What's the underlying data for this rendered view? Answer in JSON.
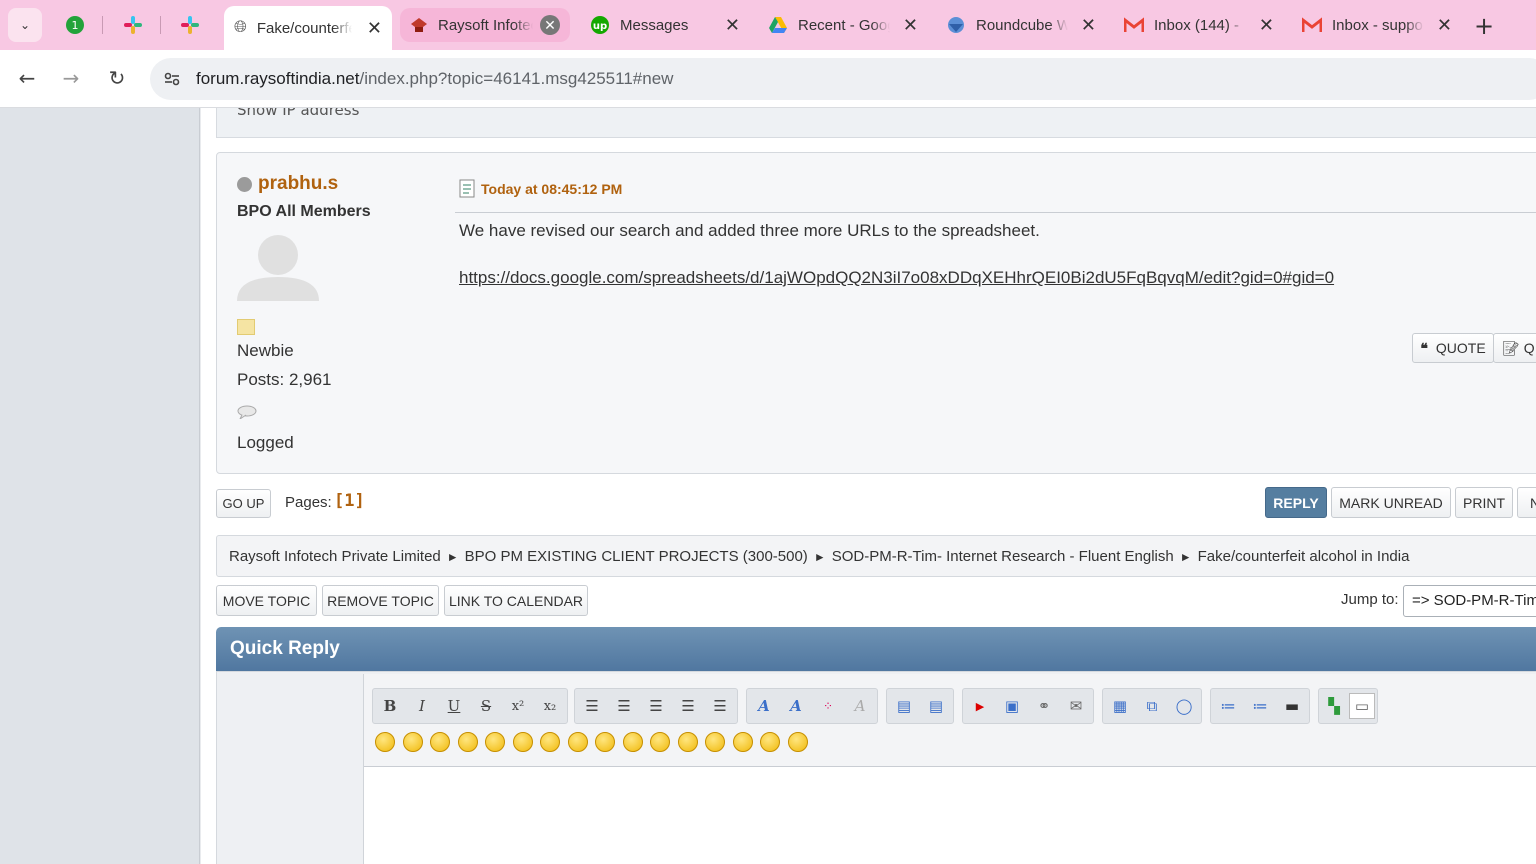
{
  "browser": {
    "tabs": [
      {
        "title": "Fake/counterfeit alcohol in India",
        "state": "active"
      },
      {
        "title": "Raysoft Infotech",
        "state": "hover"
      },
      {
        "title": "Messages",
        "state": "normal"
      },
      {
        "title": "Recent - Google Drive",
        "state": "normal"
      },
      {
        "title": "Roundcube Webmail",
        "state": "normal"
      },
      {
        "title": "Inbox (144) - ",
        "state": "normal"
      },
      {
        "title": "Inbox - support",
        "state": "normal"
      }
    ],
    "pinned_icons": [
      "notification-badge-icon",
      "slack-icon",
      "slack-icon"
    ],
    "url_host": "forum.raysoftindia.net",
    "url_rest": "/index.php?topic=46141.msg425511#new"
  },
  "prev_post": {
    "ip_text": "Show IP address"
  },
  "post": {
    "username": "prabhu.s",
    "group": "BPO All Members",
    "rank": "Newbie",
    "posts": "Posts: 2,961",
    "logged": "Logged",
    "time": "Today at 08:45:12 PM",
    "body": "We have revised our search and added three more URLs to the spreadsheet.",
    "link": "https://docs.google.com/spreadsheets/d/1ajWOpdQQ2N3iI7o08xDDqXEHhrQEI0Bi2dU5FqBqvqM/edit?gid=0#gid=0",
    "quote_label": "QUOTE",
    "quote2_label": "Q"
  },
  "nav": {
    "go_up": "GO UP",
    "pages_label": "Pages:",
    "pages_value": "[1]",
    "reply": "REPLY",
    "mark_unread": "MARK UNREAD",
    "print": "PRINT",
    "next_partial": "N"
  },
  "breadcrumb": [
    "Raysoft Infotech Private Limited",
    "BPO PM EXISTING CLIENT PROJECTS (300-500)",
    "SOD-PM-R-Tim- Internet Research - Fluent English",
    "Fake/counterfeit alcohol in India"
  ],
  "moderation": {
    "move": "MOVE TOPIC",
    "remove": "REMOVE TOPIC",
    "calendar": "LINK TO CALENDAR",
    "jump_label": "Jump to:",
    "jump_value": "=> SOD-PM-R-Tim"
  },
  "quick_reply": {
    "title": "Quick Reply",
    "toolbar_groups": [
      [
        "B",
        "I",
        "U",
        "S",
        "x²",
        "x₂"
      ],
      [
        "align-left",
        "align-center",
        "align-center2",
        "align-right",
        "justify"
      ],
      [
        "font-face",
        "font-size",
        "color",
        "clear-format"
      ],
      [
        "move-left",
        "move-right"
      ],
      [
        "youtube",
        "image",
        "link",
        "email"
      ],
      [
        "insert-table",
        "code",
        "quote"
      ],
      [
        "bulleted-list",
        "numbered-list",
        "horizontal-rule"
      ],
      [
        "source-mode",
        "wysiwyg-mode"
      ]
    ],
    "smiley_count": 16
  }
}
